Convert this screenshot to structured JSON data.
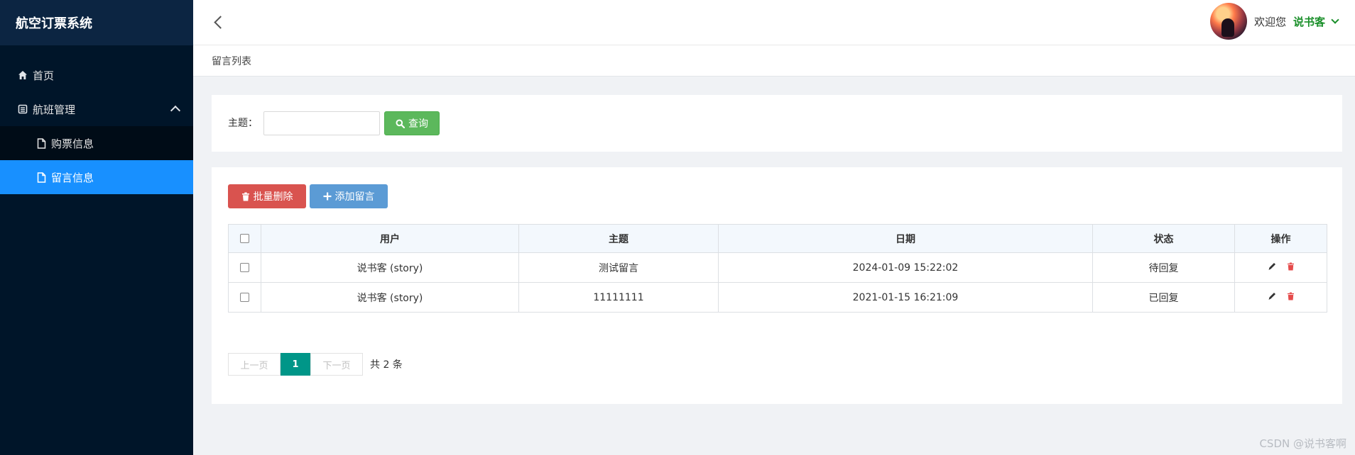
{
  "brand": "航空订票系统",
  "sidebar": {
    "home": "首页",
    "group": "航班管理",
    "items": [
      {
        "label": "购票信息",
        "active": false
      },
      {
        "label": "留言信息",
        "active": true
      }
    ]
  },
  "header": {
    "welcome": "欢迎您",
    "username": "说书客"
  },
  "breadcrumb": "留言列表",
  "search": {
    "label": "主题：",
    "value": "",
    "button": "查询"
  },
  "toolbar": {
    "batch_delete": "批量删除",
    "add": "添加留言"
  },
  "table": {
    "columns": [
      "用户",
      "主题",
      "日期",
      "状态",
      "操作"
    ],
    "rows": [
      {
        "user": "说书客 (story)",
        "topic": "测试留言",
        "date": "2024-01-09 15:22:02",
        "status": "待回复"
      },
      {
        "user": "说书客 (story)",
        "topic": "11111111",
        "date": "2021-01-15 16:21:09",
        "status": "已回复"
      }
    ]
  },
  "pager": {
    "prev": "上一页",
    "current": "1",
    "next": "下一页",
    "total": "共 2 条"
  },
  "watermark": "CSDN @说书客啊",
  "colors": {
    "sidebar_bg": "#001529",
    "active_menu": "#1890ff",
    "search_button": "#5cb85c",
    "delete_button": "#d9534f",
    "add_button": "#5b9bd5",
    "pager_current": "#009688",
    "username": "#1a8f2a"
  }
}
